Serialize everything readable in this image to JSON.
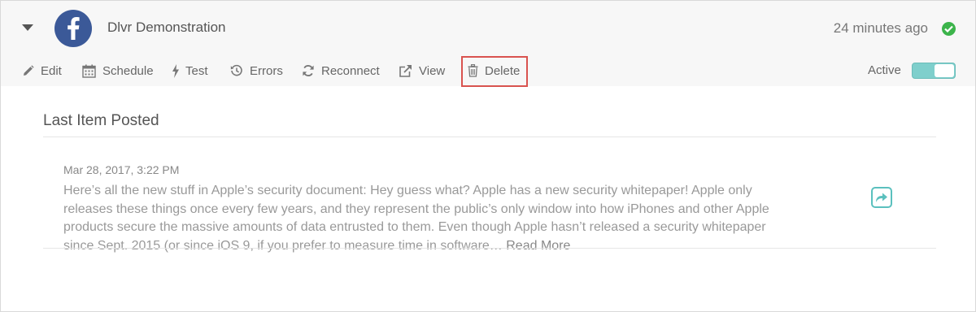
{
  "account": {
    "name": "Dlvr Demonstration",
    "time_ago": "24 minutes ago",
    "network_icon": "facebook-icon",
    "brand_color": "#3b5998",
    "status_color": "#3cb44b"
  },
  "toolbar": {
    "edit_label": "Edit",
    "schedule_label": "Schedule",
    "test_label": "Test",
    "errors_label": "Errors",
    "reconnect_label": "Reconnect",
    "view_label": "View",
    "delete_label": "Delete",
    "active_label": "Active",
    "active_on": true,
    "highlight_color": "#d9534f",
    "toggle_color": "#7fcfcc"
  },
  "last_item": {
    "title": "Last Item Posted",
    "date": "Mar 28, 2017, 3:22 PM",
    "text": "Here’s all the new stuff in Apple’s security document:  Hey guess what? Apple has a new security whitepaper! Apple only releases these things once every few years, and they represent the public’s only window into how iPhones and other Apple products secure the massive amounts of data entrusted to them. Even though Apple hasn’t released a security whitepaper since Sept. 2015 (or since iOS 9, if you prefer to measure time in software…",
    "read_more": "Read More",
    "share_color": "#5bc0be"
  }
}
